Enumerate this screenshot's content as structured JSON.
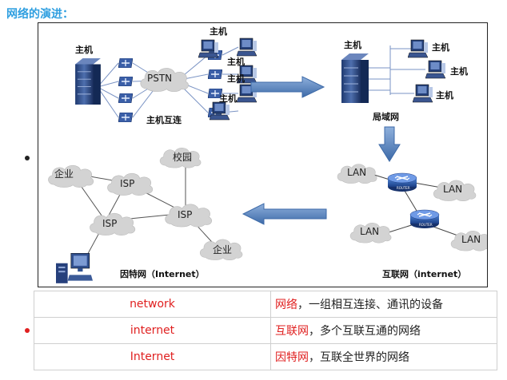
{
  "title": "网络的演进：",
  "diagram": {
    "host_label": "主机",
    "pstn_label": "PSTN",
    "interconnect_label": "主机互连",
    "lan_area_label": "局域网",
    "lan_label": "LAN",
    "router_label": "ROUTER",
    "internet_small_label": "互联网（internet）",
    "internet_big_label": "因特网（Internet）",
    "enterprise_label": "企业",
    "campus_label": "校园",
    "isp_label": "ISP"
  },
  "colors": {
    "title": "#2f9fe0",
    "highlight": "#e02020",
    "arrow": "#4f81bd"
  },
  "table": {
    "rows": [
      {
        "term": "network",
        "highlight": "网络",
        "rest": "，一组相互连接、通讯的设备"
      },
      {
        "term": "internet",
        "highlight": "互联网",
        "rest": "，多个互联互通的网络"
      },
      {
        "term": "Internet",
        "highlight": "因特网",
        "rest": "，互联全世界的网络"
      }
    ]
  }
}
